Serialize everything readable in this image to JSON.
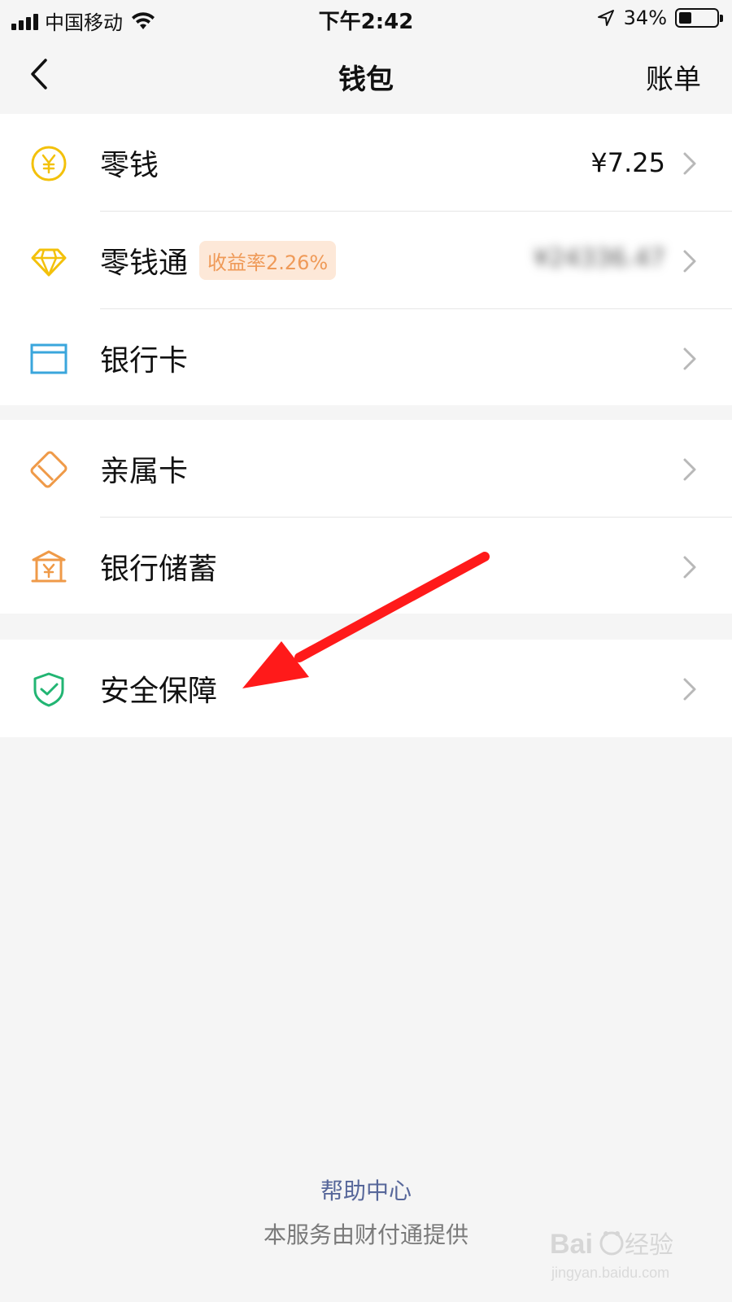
{
  "status_bar": {
    "carrier": "中国移动",
    "time": "下午2:42",
    "battery": "34%",
    "battery_level": 0.34
  },
  "nav": {
    "title": "钱包",
    "right_action": "账单"
  },
  "groups": [
    {
      "items": [
        {
          "label": "零钱",
          "value": "¥7.25",
          "icon": "yuan-coin-icon"
        },
        {
          "label": "零钱通",
          "badge": "收益率2.26%",
          "value_hidden": "¥24336.47",
          "icon": "diamond-icon"
        },
        {
          "label": "银行卡",
          "icon": "bank-card-icon"
        }
      ]
    },
    {
      "items": [
        {
          "label": "亲属卡",
          "icon": "family-card-icon"
        },
        {
          "label": "银行储蓄",
          "icon": "bank-savings-icon"
        }
      ]
    },
    {
      "items": [
        {
          "label": "安全保障",
          "icon": "shield-check-icon"
        }
      ]
    }
  ],
  "footer": {
    "help": "帮助中心",
    "provider": "本服务由财付通提供"
  },
  "colors": {
    "yellow": "#f3c10b",
    "blue": "#3aa6dc",
    "orange": "#ef9a48",
    "green": "#22b573",
    "arrow": "#ff1a1a",
    "link": "#57679a"
  }
}
